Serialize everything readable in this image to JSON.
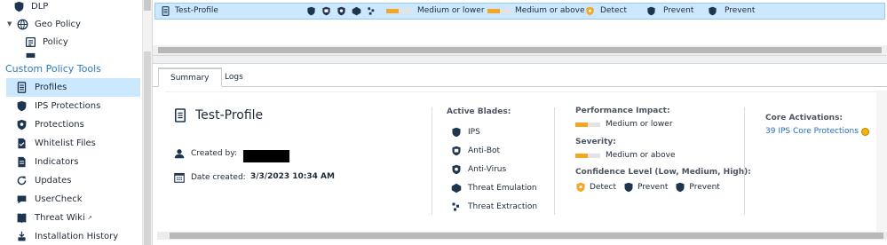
{
  "sidebar": {
    "tree": [
      {
        "label": "DLP",
        "icon": "dlp-icon"
      },
      {
        "label": "Geo Policy",
        "icon": "globe-icon"
      },
      {
        "label": "Policy",
        "icon": "policy-icon"
      }
    ],
    "section_title": "Custom Policy Tools",
    "items": [
      {
        "label": "Profiles",
        "icon": "profiles-icon",
        "selected": true
      },
      {
        "label": "IPS Protections",
        "icon": "shield-icon"
      },
      {
        "label": "Protections",
        "icon": "protections-icon"
      },
      {
        "label": "Whitelist Files",
        "icon": "whitelist-icon"
      },
      {
        "label": "Indicators",
        "icon": "indicators-icon"
      },
      {
        "label": "Updates",
        "icon": "updates-icon"
      },
      {
        "label": "UserCheck",
        "icon": "usercheck-icon"
      },
      {
        "label": "Threat Wiki",
        "icon": "threat-wiki-icon"
      },
      {
        "label": "Installation History",
        "icon": "installation-history-icon"
      }
    ]
  },
  "grid": {
    "row": {
      "name": "Test-Profile",
      "performance_label": "Medium or lower",
      "severity_label": "Medium or above",
      "confidence_low": "Detect",
      "confidence_medium": "Prevent",
      "confidence_high": "Prevent"
    }
  },
  "tabs": [
    {
      "label": "Summary",
      "active": true
    },
    {
      "label": "Logs",
      "active": false
    }
  ],
  "summary": {
    "profile_name": "Test-Profile",
    "created_by_label": "Created by:",
    "date_created_label": "Date created:",
    "date_created_value": "3/3/2023 10:34 AM",
    "active_blades_heading": "Active Blades:",
    "blades": [
      {
        "label": "IPS",
        "icon": "ips-shield-icon"
      },
      {
        "label": "Anti-Bot",
        "icon": "anti-bot-icon"
      },
      {
        "label": "Anti-Virus",
        "icon": "anti-virus-icon"
      },
      {
        "label": "Threat Emulation",
        "icon": "threat-emulation-icon"
      },
      {
        "label": "Threat Extraction",
        "icon": "threat-extraction-icon"
      }
    ],
    "performance_heading": "Performance Impact:",
    "performance_value": "Medium or lower",
    "performance_level": 0.5,
    "severity_heading": "Severity:",
    "severity_value": "Medium or above",
    "severity_level": 0.5,
    "confidence_heading": "Confidence Level (Low, Medium, High):",
    "confidence": [
      "Detect",
      "Prevent",
      "Prevent"
    ],
    "core_heading": "Core Activations:",
    "core_link": "39 IPS Core Protections"
  },
  "colors": {
    "accent": "#2a7bc4",
    "selection": "#cce8ff",
    "bar_fill": "#f5a623",
    "icon": "#1e3550"
  }
}
